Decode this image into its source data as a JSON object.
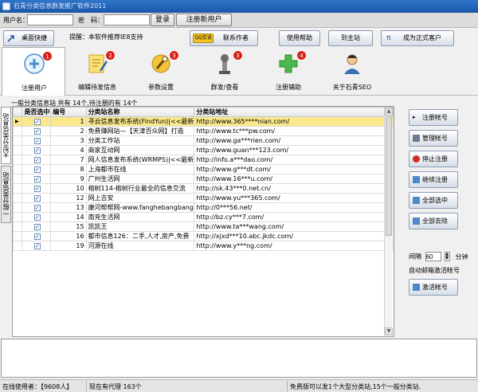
{
  "window": {
    "title": "石青分类信息群发推广软件2011"
  },
  "login": {
    "username_label": "用户名：",
    "username_value": "",
    "password_label": "密　码：",
    "password_value": "",
    "login_button": "登录",
    "register_button": "注册新用户"
  },
  "nav": {
    "desktop_shortcut": "桌面快捷",
    "notice": "提醒：本软件推荐IE8支持",
    "contact_author": "联系作者",
    "qq_badge": "QQ交谈",
    "usage_help": "使用帮助",
    "goto_site": "到主站",
    "become_customer": "成为正式客户"
  },
  "tools": [
    {
      "label": "注册用户",
      "badge": "1",
      "icon": "register-user-icon"
    },
    {
      "label": "编辑待发信息",
      "badge": "2",
      "icon": "edit-message-icon"
    },
    {
      "label": "参数设置",
      "badge": "3",
      "icon": "settings-icon"
    },
    {
      "label": "群发/查看",
      "badge": "3",
      "icon": "broadcast-icon"
    },
    {
      "label": "注册辅助",
      "badge": "4",
      "icon": "register-assist-icon"
    },
    {
      "label": "关于石青SEO",
      "badge": "",
      "icon": "about-icon"
    }
  ],
  "info_line": "一般分类信息站 共有 14个,待注册的有 14个",
  "side_tabs": {
    "large": "大型分类信息站",
    "general": "一般分类信息站"
  },
  "grid": {
    "headers": [
      "是否选中",
      "编号",
      "分类站名称",
      "分类站地址"
    ],
    "rows": [
      {
        "checked": "✓",
        "id": "1",
        "name": "寻云信息发布系统(FindYun)|<<最新",
        "url": "http://www.365****nian.com/",
        "selected": true
      },
      {
        "checked": "✓",
        "id": "2",
        "name": "免费赚网站—【天津百众网】打造",
        "url": "http://www.tc***pw.com/",
        "selected": false
      },
      {
        "checked": "✓",
        "id": "3",
        "name": "分类工作站",
        "url": "http://www.ga***rien.com/",
        "selected": false
      },
      {
        "checked": "✓",
        "id": "4",
        "name": "商家互动网",
        "url": "http://www.guan***123.com/",
        "selected": false
      },
      {
        "checked": "✓",
        "id": "7",
        "name": "网人信息发布系统(WRMPS)|<<最新",
        "url": "http://info.a***dao.com/",
        "selected": false
      },
      {
        "checked": "✓",
        "id": "8",
        "name": "上海都市在线",
        "url": "http://www.g***dt.com/",
        "selected": false
      },
      {
        "checked": "✓",
        "id": "9",
        "name": "广州生活网",
        "url": "http://www.16***u.com/",
        "selected": false
      },
      {
        "checked": "✓",
        "id": "10",
        "name": "榕树114-榕树行业最全的信息交流",
        "url": "http://sk.43***0.net.cn/",
        "selected": false
      },
      {
        "checked": "✓",
        "id": "12",
        "name": "网上吉安",
        "url": "http://www.yu***365.com/",
        "selected": false
      },
      {
        "checked": "✓",
        "id": "13",
        "name": "康河帮帮网-www.fanghebangbang",
        "url": "http://0***56.net/",
        "selected": false
      },
      {
        "checked": "✓",
        "id": "14",
        "name": "南充生活网",
        "url": "http://bz.cy***7.com/",
        "selected": false
      },
      {
        "checked": "✓",
        "id": "15",
        "name": "凯凯王",
        "url": "http://www.ta***wang.com/",
        "selected": false
      },
      {
        "checked": "✓",
        "id": "16",
        "name": "都市信息126：二手,人才,房产,免费",
        "url": "http://xjxd***10.abc.jkdc.com/",
        "selected": false
      },
      {
        "checked": "✓",
        "id": "19",
        "name": "河源在线",
        "url": "http://www.y***ng.com/",
        "selected": false
      }
    ]
  },
  "right_panel": {
    "register_account": "注册帐号",
    "manage_account": "管理帐号",
    "stop_register": "停止注册",
    "continue_register": "继续注册",
    "select_all": "全部选中",
    "deselect_all": "全部去除",
    "interval_label": "间隔",
    "interval_value": "60",
    "interval_unit": "分钟",
    "auto_label": "自动邮箱激活帐号",
    "activate_account": "激活帐号"
  },
  "status": {
    "computer_user": "在线使用者：【9608人】",
    "proxy": "现在有代理 163个",
    "free_info": "免费版可以发1个大型分类站,15个一般分类站."
  },
  "colors": {
    "selected_row": "#fbe88a",
    "title_bar": "#1a56a8",
    "badge": "#d8201a"
  }
}
